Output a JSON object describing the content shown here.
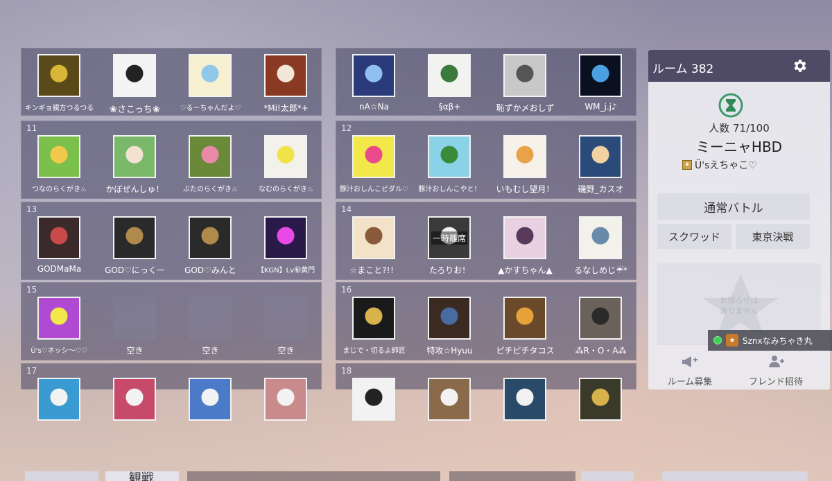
{
  "groups": [
    {
      "num": "",
      "slots": [
        {
          "name": "キンギョ親方つるつる",
          "size": "small",
          "color": "#5a4a1a",
          "accent": "#d8b638"
        },
        {
          "name": "❀さこっち❀",
          "size": "large",
          "color": "#f4f4f4",
          "accent": "#222222"
        },
        {
          "name": "♡るーちゃんだよ♡",
          "size": "small",
          "color": "#f6f0d0",
          "accent": "#8fc8e8"
        },
        {
          "name": "*Mi!太郎*+",
          "size": "normal",
          "color": "#8a3a22",
          "accent": "#f2e6d8"
        }
      ]
    },
    {
      "num": "",
      "slots": [
        {
          "name": "nA☆Na",
          "size": "normal",
          "color": "#2a3a7a",
          "accent": "#8fc0f0"
        },
        {
          "name": "§αβ+",
          "size": "normal",
          "color": "#f2f2f0",
          "accent": "#3a7a3a"
        },
        {
          "name": "恥ずか〆おしず",
          "size": "normal",
          "color": "#c8c8c8",
          "accent": "#555555"
        },
        {
          "name": "WM_j.j♪",
          "size": "normal",
          "color": "#0a1020",
          "accent": "#4aa0e0"
        }
      ]
    },
    {
      "num": "11",
      "slots": [
        {
          "name": "つなのらくがき♨",
          "size": "small",
          "color": "#7ac04a",
          "accent": "#f2c84a"
        },
        {
          "name": "かぼぜんしゅ！",
          "size": "normal",
          "color": "#7ab86a",
          "accent": "#f2e2d2"
        },
        {
          "name": "ぶたのらくがき♨",
          "size": "small",
          "color": "#6a8a3a",
          "accent": "#e88aa8"
        },
        {
          "name": "なむのらくがき♨",
          "size": "small",
          "color": "#f2f2ea",
          "accent": "#f2e24a"
        }
      ]
    },
    {
      "num": "12",
      "slots": [
        {
          "name": "豚汁おしんこビダル♡",
          "size": "small",
          "color": "#f2e84a",
          "accent": "#e84a8a"
        },
        {
          "name": "豚汁おしんこやと！",
          "size": "small",
          "color": "#8ad2e8",
          "accent": "#3a8a3a"
        },
        {
          "name": "いもむし望月！",
          "size": "normal",
          "color": "#f6f2ea",
          "accent": "#e8a24a"
        },
        {
          "name": "磯野_カスオ",
          "size": "normal",
          "color": "#2a4a7a",
          "accent": "#f2d2a2"
        }
      ]
    },
    {
      "num": "13",
      "slots": [
        {
          "name": "GODMaMa",
          "size": "normal",
          "color": "#3a2a2a",
          "accent": "#c84a4a"
        },
        {
          "name": "GOD♡にっくー",
          "size": "normal",
          "color": "#2a2a2a",
          "accent": "#b08a4a"
        },
        {
          "name": "GOD♡みんと",
          "size": "normal",
          "color": "#2a2a2a",
          "accent": "#b08a4a"
        },
        {
          "name": "【KGN】Lv㊙黄門",
          "size": "small",
          "color": "#2a1a4a",
          "accent": "#e84ae8"
        }
      ]
    },
    {
      "num": "14",
      "slots": [
        {
          "name": "☆まこと?!！",
          "size": "normal",
          "color": "#f2e2c8",
          "accent": "#8a5a3a"
        },
        {
          "name": "たろりお！",
          "size": "normal",
          "color": "#3a3a3a",
          "accent": "#f2f2f2",
          "overlay": "一時離席"
        },
        {
          "name": "▲かすちゃん▲",
          "size": "normal",
          "color": "#e8d2e2",
          "accent": "#5a3a5a"
        },
        {
          "name": "るなしめじ☔*",
          "size": "normal",
          "color": "#f2f2ea",
          "accent": "#6a8aaa"
        }
      ]
    },
    {
      "num": "15",
      "slots": [
        {
          "name": "Ü's♡ネッシ〜♡♡",
          "size": "small",
          "color": "#b04ad2",
          "accent": "#f2e84a"
        },
        {
          "name": "空き",
          "size": "normal",
          "empty": true
        },
        {
          "name": "空き",
          "size": "normal",
          "empty": true
        },
        {
          "name": "空き",
          "size": "normal",
          "empty": true
        }
      ]
    },
    {
      "num": "16",
      "slots": [
        {
          "name": "まじで・切るよ師匠",
          "size": "small",
          "color": "#1a1a1a",
          "accent": "#d8b24a"
        },
        {
          "name": "特攻☆Hyuu",
          "size": "normal",
          "color": "#3a2a22",
          "accent": "#4a6aa2"
        },
        {
          "name": "ピチピチタコス",
          "size": "normal",
          "color": "#6a4a2a",
          "accent": "#e8a23a"
        },
        {
          "name": "⁂R・O・A⁂",
          "size": "normal",
          "color": "#6a625a",
          "accent": "#2a2a2a"
        }
      ]
    },
    {
      "num": "17",
      "slots": [
        {
          "name": "",
          "size": "normal",
          "color": "#3a9ad2",
          "accent": "#f2f2f2"
        },
        {
          "name": "",
          "size": "normal",
          "color": "#c84a6a",
          "accent": "#f2f2f2"
        },
        {
          "name": "",
          "size": "normal",
          "color": "#4a7ac8",
          "accent": "#f2f2f2"
        },
        {
          "name": "",
          "size": "normal",
          "color": "#c88a8a",
          "accent": "#f2f2f2"
        }
      ]
    },
    {
      "num": "18",
      "slots": [
        {
          "name": "",
          "size": "normal",
          "color": "#f2f2f2",
          "accent": "#222222"
        },
        {
          "name": "",
          "size": "normal",
          "color": "#8a6a4a",
          "accent": "#f2f2f2"
        },
        {
          "name": "",
          "size": "normal",
          "color": "#2a4a6a",
          "accent": "#f2f2f2"
        },
        {
          "name": "",
          "size": "normal",
          "color": "#3a3a2a",
          "accent": "#d8b24a"
        }
      ]
    }
  ],
  "panel": {
    "room_title": "ルーム 382",
    "people_count": "人数 71/100",
    "room_name": "ミーニャHBD",
    "host_name": "Ü'sえちゃこ♡",
    "mode_main": "通常バトル",
    "mode_squad": "スクワッド",
    "mode_tokyo": "東京決戦",
    "notice": "お知らせは\nありません",
    "recruit_label": "ルーム募集",
    "invite_label": "フレンド招待"
  },
  "toast": {
    "name": "Sznxなみちゃき丸"
  },
  "bottom": {
    "spectate_label": "観戦"
  },
  "colors": {
    "header": "#4f4b66",
    "group_bg": "rgba(70,68,98,0.55)",
    "online": "#39d353"
  }
}
